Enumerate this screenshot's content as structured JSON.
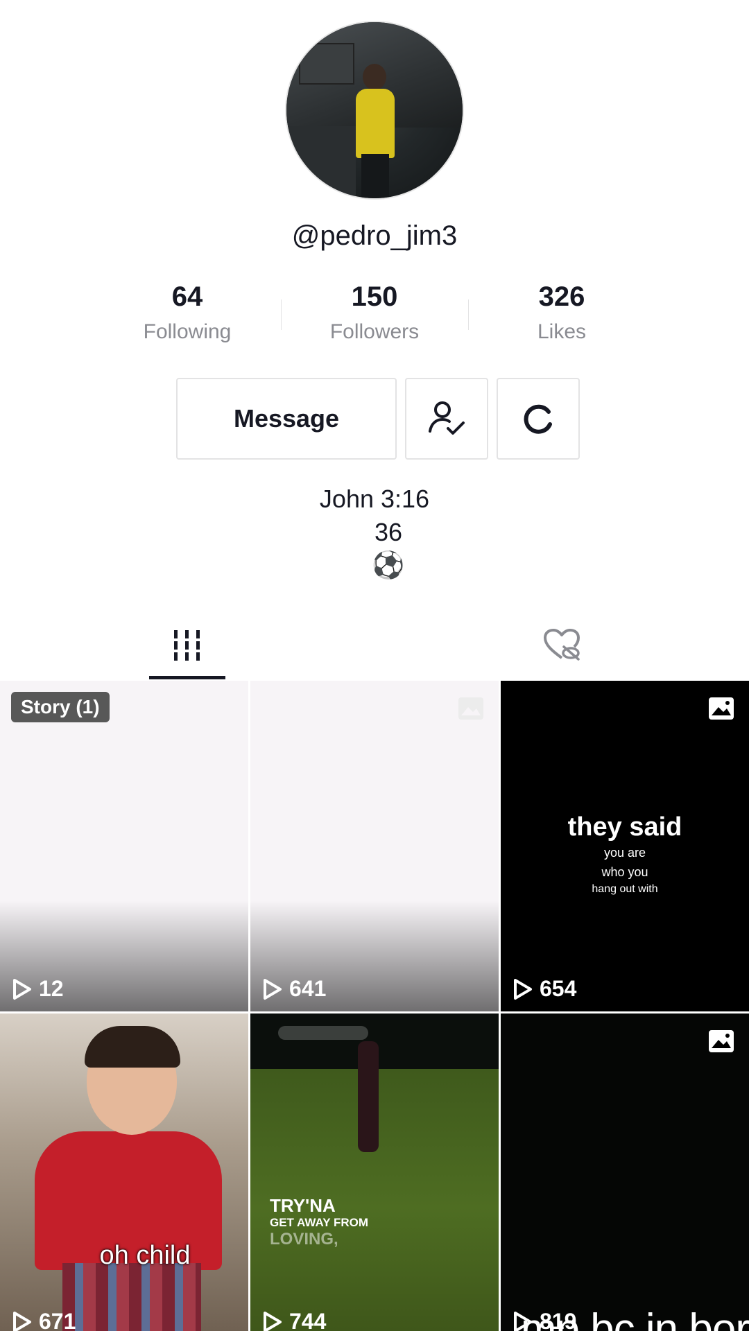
{
  "profile": {
    "username": "@pedro_jim3",
    "stats": [
      {
        "value": "64",
        "label": "Following"
      },
      {
        "value": "150",
        "label": "Followers"
      },
      {
        "value": "326",
        "label": "Likes"
      }
    ],
    "buttons": {
      "message": "Message",
      "friends_icon": "person-check-icon",
      "more_icon": "refresh-icon"
    },
    "bio": {
      "line1": "John 3:16",
      "line2": "36",
      "line3": "⚽"
    }
  },
  "tabs": {
    "videos_icon": "grid-bars-icon",
    "liked_icon": "hidden-heart-icon"
  },
  "videos": [
    {
      "views": "12",
      "badge": "Story (1)"
    },
    {
      "views": "641"
    },
    {
      "views": "654",
      "text_big": "they said",
      "text_small_1": "you are",
      "text_small_2": "who you",
      "text_small_3": "hang out with"
    },
    {
      "views": "671",
      "caption": "oh child"
    },
    {
      "views": "744",
      "caption_1": "TRY'NA",
      "caption_2": "GET AWAY FROM",
      "caption_3": "LOVING,"
    },
    {
      "views": "819",
      "overlay": "mp bc in bor"
    }
  ],
  "colors": {
    "text_primary": "#161823",
    "text_secondary": "#8a8b91",
    "border": "#e3e3e4"
  }
}
